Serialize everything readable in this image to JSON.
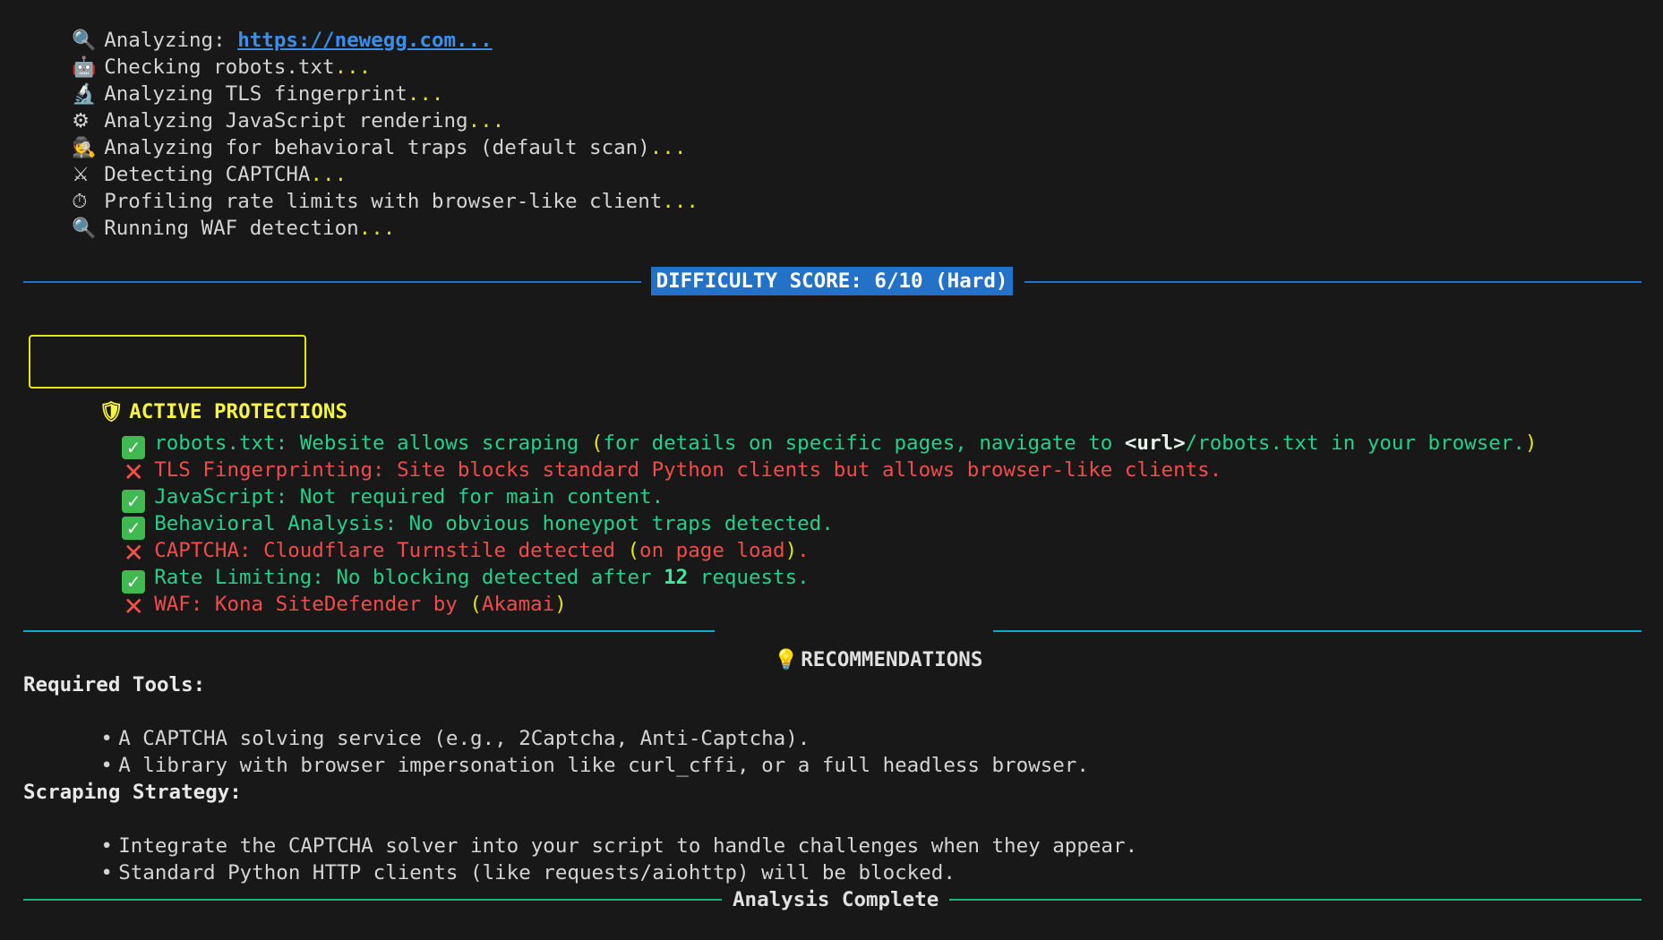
{
  "progress": {
    "analyzing_prefix": "Analyzing: ",
    "analyzing_url": "https://newegg.com...",
    "steps": [
      {
        "icon": "magnifier-icon",
        "glyph": "🔍",
        "text": "Analyzing: "
      },
      {
        "icon": "robot-icon",
        "glyph": "🤖",
        "text": "Checking robots.txt"
      },
      {
        "icon": "microscope-icon",
        "glyph": "🔬",
        "text": "Analyzing TLS fingerprint"
      },
      {
        "icon": "gear-icon",
        "glyph": "⚙",
        "text": "Analyzing JavaScript rendering"
      },
      {
        "icon": "detective-icon",
        "glyph": "🕵",
        "text": "Analyzing for behavioral traps (default scan)"
      },
      {
        "icon": "crossed-swords-icon",
        "glyph": "⚔",
        "text": "Detecting CAPTCHA"
      },
      {
        "icon": "stopwatch-icon",
        "glyph": "⏱",
        "text": "Profiling rate limits with browser-like client"
      },
      {
        "icon": "magnifier-icon",
        "glyph": "🔍",
        "text": "Running WAF detection"
      }
    ],
    "ellipsis": "..."
  },
  "difficulty": {
    "label": "DIFFICULTY SCORE: 6/10 (Hard)",
    "score": 6,
    "max": 10,
    "rating": "Hard"
  },
  "protections": {
    "title": "ACTIVE PROTECTIONS",
    "title_icon": "shield-icon",
    "title_glyph": "🛡",
    "items": [
      {
        "status": "pass",
        "parts": [
          "robots.txt: Website allows scraping ",
          "(",
          "for details on specific pages, navigate to ",
          "<url>",
          "/robots.txt in your browser.",
          ")"
        ]
      },
      {
        "status": "fail",
        "parts": [
          "TLS Fingerprinting: Site blocks standard Python clients but allows browser-like clients."
        ]
      },
      {
        "status": "pass",
        "parts": [
          "JavaScript: Not required for main content."
        ]
      },
      {
        "status": "pass",
        "parts": [
          "Behavioral Analysis: No obvious honeypot traps detected."
        ]
      },
      {
        "status": "fail",
        "parts": [
          "CAPTCHA: Cloudflare Turnstile detected ",
          "(",
          "on page load",
          ")",
          "."
        ]
      },
      {
        "status": "pass",
        "parts": [
          "Rate Limiting: No blocking detected after ",
          "12",
          " requests."
        ]
      },
      {
        "status": "fail",
        "parts": [
          "WAF: Kona SiteDefender by ",
          "(",
          "Akamai",
          ")"
        ]
      }
    ]
  },
  "recommendations": {
    "title": "RECOMMENDATIONS",
    "title_icon": "lightbulb-icon",
    "title_glyph": "💡",
    "tools_heading": "Required Tools:",
    "tools": [
      "A CAPTCHA solving service (e.g., 2Captcha, Anti-Captcha).",
      "A library with browser impersonation like curl_cffi, or a full headless browser."
    ],
    "strategy_heading": "Scraping Strategy:",
    "strategy": [
      "Integrate the CAPTCHA solver into your script to handle challenges when they appear.",
      "Standard Python HTTP clients (like requests/aiohttp) will be blocked."
    ],
    "bullet": "•"
  },
  "footer": {
    "label": "Analysis Complete"
  },
  "colors": {
    "background": "#181818",
    "pass": "#23d18b",
    "fail": "#f14c4c",
    "accent_blue": "#2472c8",
    "accent_yellow": "#e5e510"
  }
}
